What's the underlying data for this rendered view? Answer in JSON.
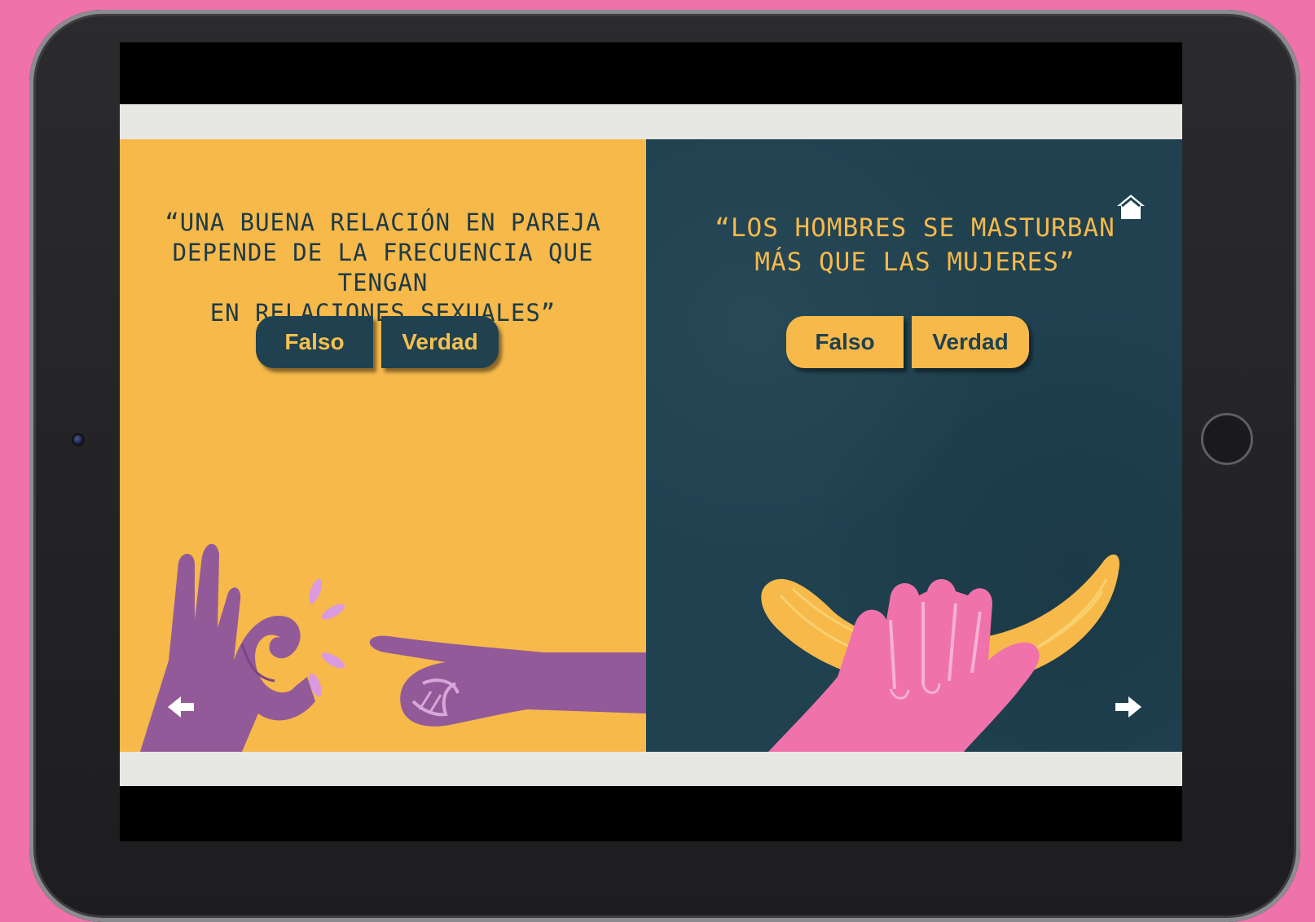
{
  "pages": [
    {
      "id": "left",
      "quote": "“UNA BUENA RELACIÓN EN PAREJA\nDEPENDE DE LA FRECUENCIA QUE TENGAN\nEN RELACIONES SEXUALES”",
      "buttons": {
        "false_label": "Falso",
        "true_label": "Verdad"
      },
      "illustration": "purple-hands-ok-gesture"
    },
    {
      "id": "right",
      "quote": "“LOS HOMBRES SE MASTURBAN\nMÁS QUE LAS MUJERES”",
      "buttons": {
        "false_label": "Falso",
        "true_label": "Verdad"
      },
      "illustration": "pink-hand-holding-banana"
    }
  ],
  "navigation": {
    "home_icon": "home-icon",
    "prev_icon": "arrow-left-icon",
    "next_icon": "arrow-right-icon"
  },
  "colors": {
    "background_pink": "#ef72ab",
    "panel_yellow": "#f6b94a",
    "panel_teal": "#1f4150",
    "hand_purple": "#935a99",
    "hand_pink": "#ef72ab"
  }
}
